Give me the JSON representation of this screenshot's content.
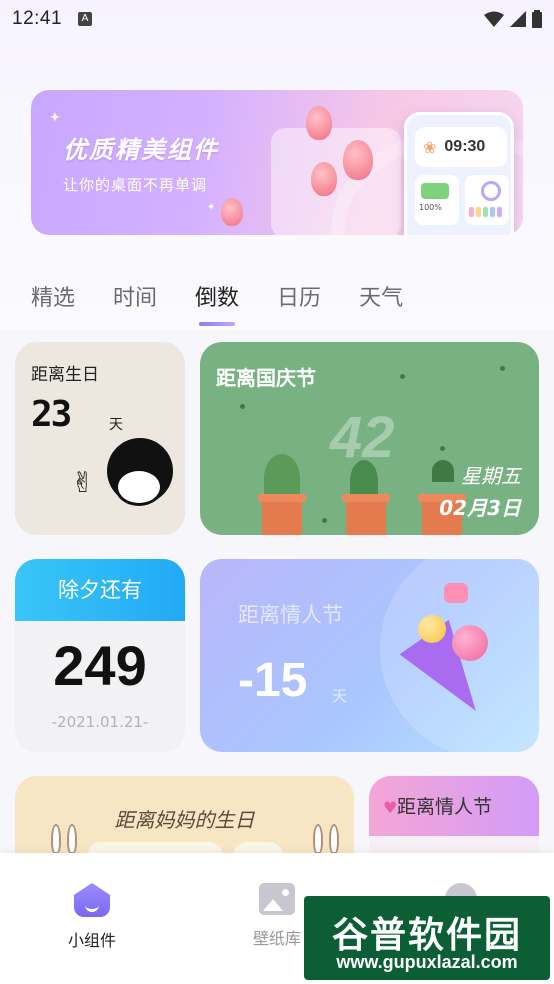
{
  "status_bar": {
    "time": "12:41",
    "notification_icon": "A"
  },
  "banner": {
    "title": "优质精美组件",
    "subtitle": "让你的桌面不再单调",
    "clock_time": "09:30",
    "battery_percent": "100%"
  },
  "tabs": [
    {
      "label": "精选",
      "active": false
    },
    {
      "label": "时间",
      "active": false
    },
    {
      "label": "倒数",
      "active": true
    },
    {
      "label": "日历",
      "active": false
    },
    {
      "label": "天气",
      "active": false
    }
  ],
  "cards": {
    "birthday": {
      "label": "距离生日",
      "number": "23",
      "unit": "天"
    },
    "national_day": {
      "label": "距离国庆节",
      "number": "42",
      "weekday": "星期五",
      "date": "02月3日"
    },
    "new_year_eve": {
      "label": "除夕还有",
      "number": "249",
      "date": "-2021.01.21-"
    },
    "valentine": {
      "label": "距离情人节",
      "number": "-15",
      "unit": "天"
    },
    "mom_birthday": {
      "label": "距离妈妈的生日"
    },
    "valentine_small": {
      "label": "距离情人节"
    }
  },
  "bottom_nav": [
    {
      "label": "小组件",
      "icon": "home-icon",
      "active": true,
      "color": "#222222"
    },
    {
      "label": "壁纸库",
      "icon": "picture-icon",
      "active": false,
      "color": "#999999"
    },
    {
      "label": "",
      "icon": "profile-icon",
      "active": false,
      "color": "#999999"
    }
  ],
  "watermark": {
    "title": "谷普软件园",
    "url": "www.gupuxlazal.com"
  },
  "colors": {
    "accent": "#8c7cf4",
    "national_card": "#78b182",
    "new_year_header": "#2bb6f6",
    "valentine_card": "#aebcff",
    "mom_card": "#f6e6c4"
  }
}
